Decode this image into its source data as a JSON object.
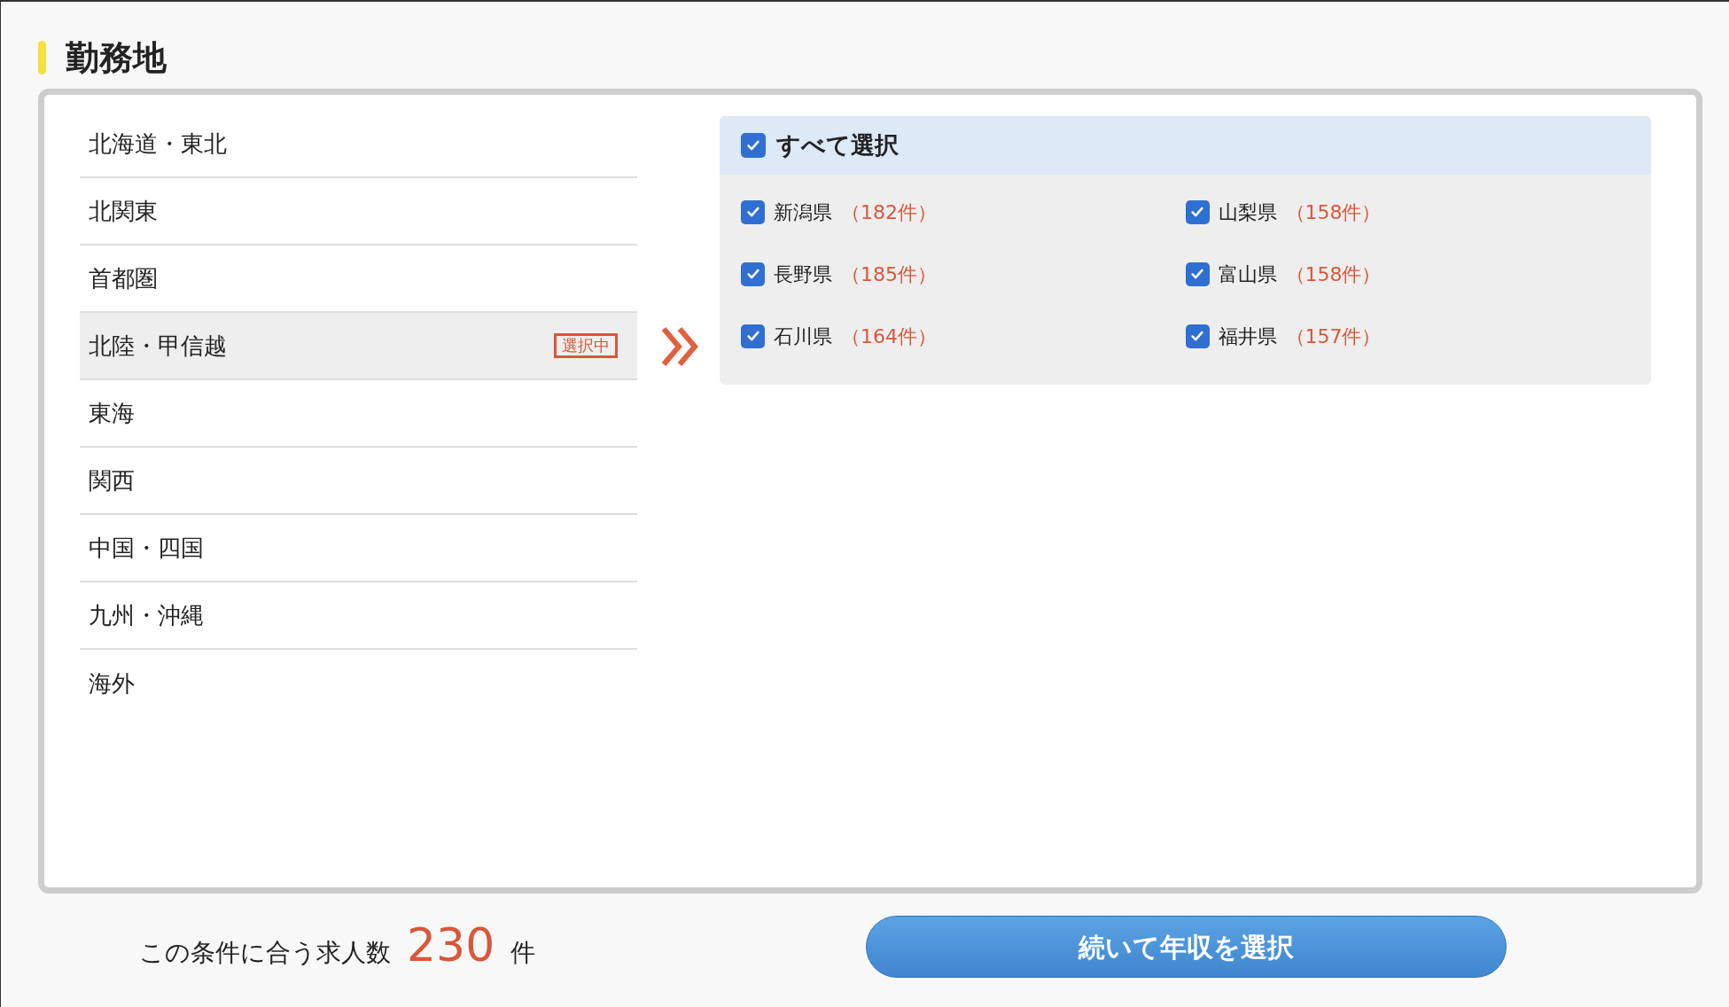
{
  "title": "勤務地",
  "regions": [
    {
      "label": "北海道・東北",
      "selected": false
    },
    {
      "label": "北関東",
      "selected": false
    },
    {
      "label": "首都圏",
      "selected": false
    },
    {
      "label": "北陸・甲信越",
      "selected": true,
      "badge": "選択中"
    },
    {
      "label": "東海",
      "selected": false
    },
    {
      "label": "関西",
      "selected": false
    },
    {
      "label": "中国・四国",
      "selected": false
    },
    {
      "label": "九州・沖縄",
      "selected": false
    },
    {
      "label": "海外",
      "selected": false
    }
  ],
  "select_all": {
    "label": "すべて選択",
    "checked": true
  },
  "prefectures": [
    {
      "name": "新潟県",
      "count": "（182件）",
      "checked": true
    },
    {
      "name": "山梨県",
      "count": "（158件）",
      "checked": true
    },
    {
      "name": "長野県",
      "count": "（185件）",
      "checked": true
    },
    {
      "name": "富山県",
      "count": "（158件）",
      "checked": true
    },
    {
      "name": "石川県",
      "count": "（164件）",
      "checked": true
    },
    {
      "name": "福井県",
      "count": "（157件）",
      "checked": true
    }
  ],
  "footer": {
    "label": "この条件に合う求人数",
    "count": "230",
    "unit": "件"
  },
  "next_button": "続いて年収を選択"
}
